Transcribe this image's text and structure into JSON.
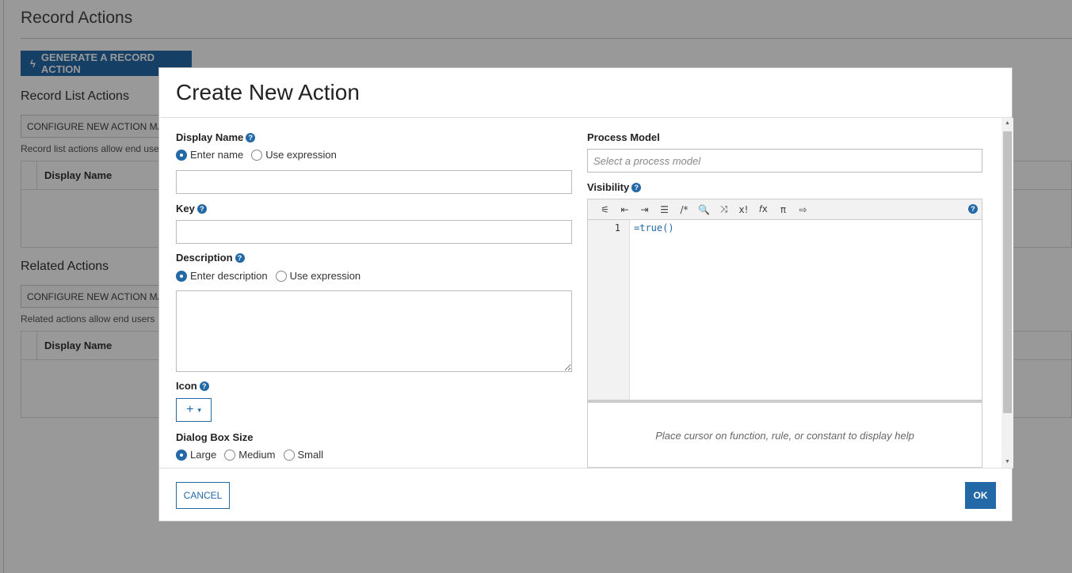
{
  "background": {
    "page_title": "Record Actions",
    "generate_button_label": "GENERATE A RECORD ACTION",
    "record_list_actions": {
      "heading": "Record List Actions",
      "configure_label": "CONFIGURE NEW ACTION MA",
      "note": "Record list actions allow end use",
      "column_header": "Display Name"
    },
    "related_actions": {
      "heading": "Related Actions",
      "configure_label": "CONFIGURE NEW ACTION MA",
      "note": "Related actions allow end users",
      "column_header": "Display Name"
    }
  },
  "modal": {
    "title": "Create New Action",
    "display_name": {
      "label": "Display Name",
      "options": [
        "Enter name",
        "Use expression"
      ],
      "selected": "Enter name",
      "value": ""
    },
    "key": {
      "label": "Key",
      "value": ""
    },
    "description": {
      "label": "Description",
      "options": [
        "Enter description",
        "Use expression"
      ],
      "selected": "Enter description",
      "value": ""
    },
    "icon": {
      "label": "Icon",
      "picker_glyph": "+",
      "caret": "▾"
    },
    "dialog_box_size": {
      "label": "Dialog Box Size",
      "options": [
        "Large",
        "Medium",
        "Small"
      ],
      "selected": "Large"
    },
    "process_model": {
      "label": "Process Model",
      "placeholder": "Select a process model"
    },
    "visibility": {
      "label": "Visibility",
      "toolbar_icons": [
        "magic-wand-icon",
        "outdent-icon",
        "indent-icon",
        "align-icon",
        "comment-icon",
        "search-icon",
        "shuffle-icon",
        "x-bang-icon",
        "function-icon",
        "pi-icon",
        "export-icon"
      ],
      "toolbar_glyphs": {
        "magic-wand-icon": "⚟",
        "outdent-icon": "⇤",
        "indent-icon": "⇥",
        "align-icon": "☰",
        "comment-icon": "/*",
        "search-icon": "🔍",
        "shuffle-icon": "⤨",
        "x-bang-icon": "x!",
        "function-icon": "𝑓x",
        "pi-icon": "π",
        "export-icon": "⇨"
      },
      "line_number": "1",
      "code": "=true()",
      "help_text": "Place cursor on function, rule, or constant to display help"
    },
    "cancel_label": "CANCEL",
    "ok_label": "OK",
    "help_glyph": "?"
  },
  "colors": {
    "accent": "#2369a7",
    "overlay": "rgba(0,0,0,0.4)"
  }
}
